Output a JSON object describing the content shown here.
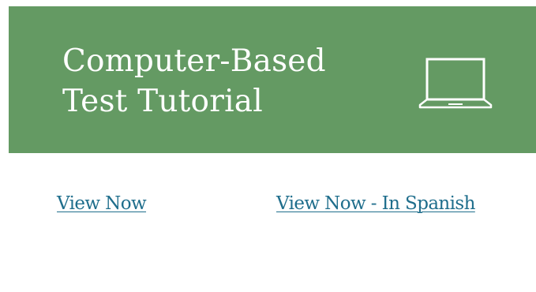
{
  "banner": {
    "title_line1": "Computer-Based",
    "title_line2": "Test Tutorial",
    "icon": "laptop-icon",
    "background_color": "#649a63",
    "text_color": "#ffffff"
  },
  "links": {
    "view_now": "View Now",
    "view_now_spanish": "View Now - In Spanish",
    "color": "#1f6e8c"
  }
}
